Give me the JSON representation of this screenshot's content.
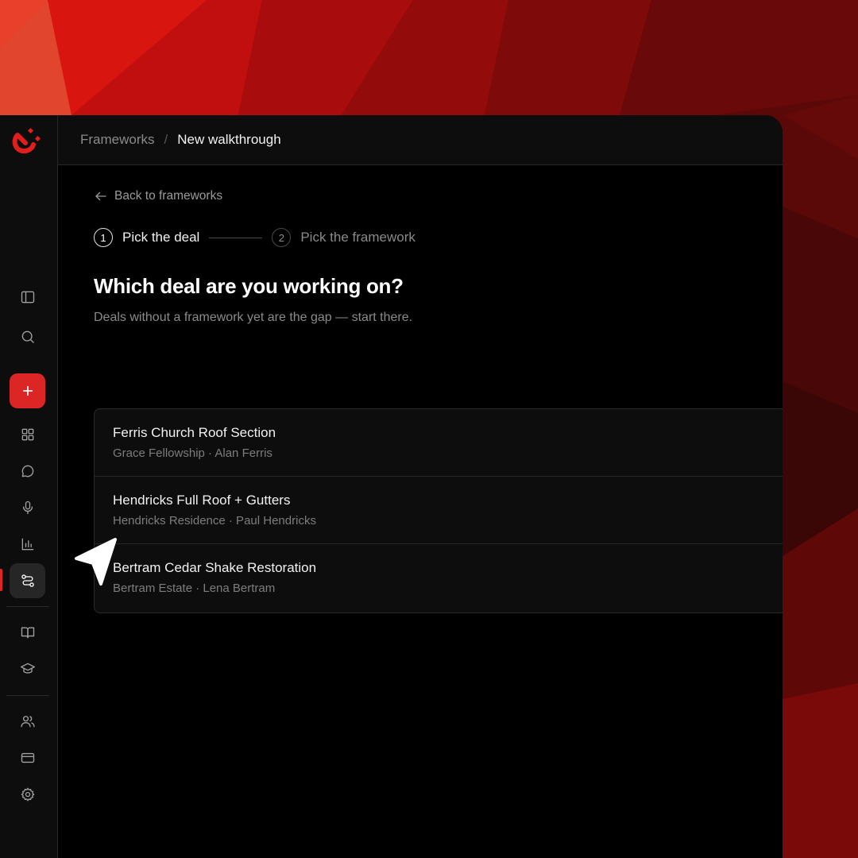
{
  "breadcrumb": {
    "parent": "Frameworks",
    "separator": "/",
    "current": "New walkthrough"
  },
  "back_link": "Back to frameworks",
  "steps": [
    {
      "number": "1",
      "label": "Pick the deal",
      "active": true
    },
    {
      "number": "2",
      "label": "Pick the framework",
      "active": false
    }
  ],
  "heading": "Which deal are you working on?",
  "subheading": "Deals without a framework yet are the gap — start there.",
  "deals": [
    {
      "title": "Ferris Church Roof Section",
      "meta": "Grace Fellowship · Alan Ferris"
    },
    {
      "title": "Hendricks Full Roof + Gutters",
      "meta": "Hendricks Residence · Paul Hendricks"
    },
    {
      "title": "Bertram Cedar Shake Restoration",
      "meta": "Bertram Estate · Lena Bertram"
    }
  ],
  "sidebar": {
    "icons": [
      "panel-toggle-icon",
      "search-icon",
      "plus-icon",
      "grid-icon",
      "chat-icon",
      "mic-icon",
      "bar-chart-icon",
      "route-icon",
      "book-icon",
      "graduation-cap-icon",
      "users-icon",
      "credit-card-icon",
      "gear-icon"
    ],
    "active_item": "route-icon"
  },
  "colors": {
    "accent": "#dc2626",
    "background": "#000000",
    "sidebar": "#0d0d0d"
  }
}
